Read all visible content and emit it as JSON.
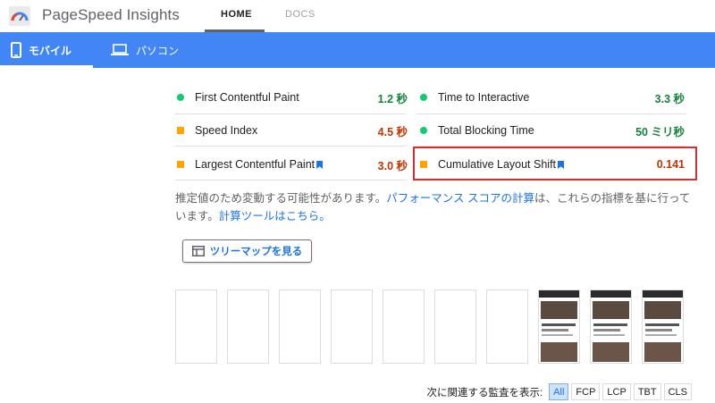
{
  "header": {
    "app_title": "PageSpeed Insights",
    "nav": [
      {
        "label": "HOME",
        "active": true
      },
      {
        "label": "DOCS",
        "active": false
      }
    ]
  },
  "device_tabs": [
    {
      "label": "モバイル",
      "icon": "smartphone-icon",
      "active": true
    },
    {
      "label": "パソコン",
      "icon": "laptop-icon",
      "active": false
    }
  ],
  "metrics": [
    {
      "label": "First Contentful Paint",
      "value": "1.2 秒",
      "status": "good"
    },
    {
      "label": "Time to Interactive",
      "value": "3.3 秒",
      "status": "good"
    },
    {
      "label": "Speed Index",
      "value": "4.5 秒",
      "status": "average"
    },
    {
      "label": "Total Blocking Time",
      "value": "50 ミリ秒",
      "status": "good"
    },
    {
      "label": "Largest Contentful Paint",
      "value": "3.0 秒",
      "status": "average"
    },
    {
      "label": "Cumulative Layout Shift",
      "value": "0.141",
      "status": "average"
    }
  ],
  "note": {
    "text1": "推定値のため変動する可能性があります。",
    "link1": "パフォーマンス スコアの計算",
    "text2": "は、これらの指標を基に行っています。",
    "link2": "計算ツールはこちら。"
  },
  "treemap_button": "ツリーマップを見る",
  "filmstrip_frame_count": 10,
  "filmstrip_loaded_from": 7,
  "filter": {
    "label": "次に関連する監査を表示:",
    "chips": [
      "All",
      "FCP",
      "LCP",
      "TBT",
      "CLS"
    ],
    "active": "All"
  },
  "colors": {
    "brand_blue": "#4285f4",
    "good": "#0cce6b",
    "average": "#ffa400",
    "highlight_border": "#d32f2f",
    "link": "#1a73e8"
  }
}
